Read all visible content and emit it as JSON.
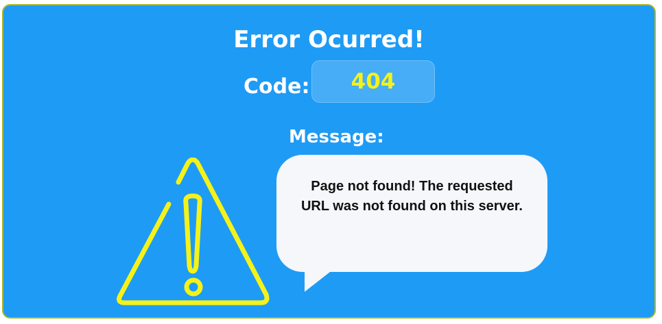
{
  "error": {
    "title": "Error Ocurred!",
    "code_label": "Code:",
    "code_value": "404",
    "message_label": "Message:",
    "message_text": "Page not found! The requested URL was not found on this server."
  },
  "colors": {
    "background": "#1e9bf5",
    "border": "#a8b82a",
    "accent": "#f5f21a",
    "bubble": "#f5f7fa"
  },
  "icons": {
    "warning": "warning-triangle-icon"
  }
}
